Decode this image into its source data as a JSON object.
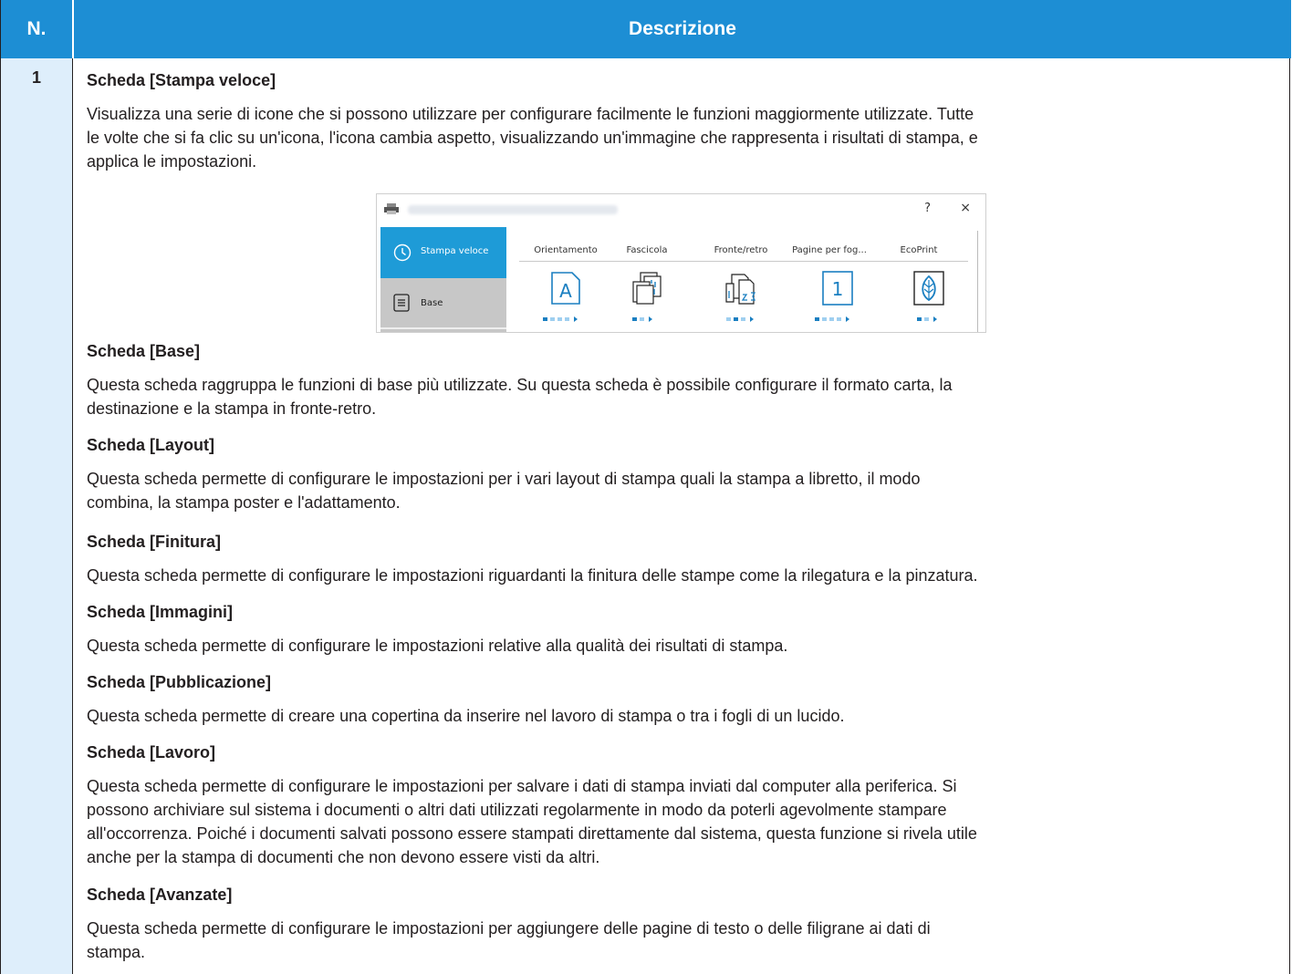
{
  "header": {
    "col_number": "N.",
    "col_description": "Descrizione"
  },
  "row": {
    "number": "1",
    "sections": [
      {
        "title": "Scheda [Stampa veloce]",
        "lines": [
          "Visualizza una serie di icone che si possono utilizzare per configurare facilmente le funzioni maggiormente utilizzate. Tutte",
          "le volte che si fa clic su un'icona, l'icona cambia aspetto, visualizzando un'immagine che rappresenta i risultati di stampa, e",
          "applica le impostazioni."
        ]
      },
      {
        "title": "Scheda [Base]",
        "lines": [
          "Questa scheda raggruppa le funzioni di base più utilizzate. Su questa scheda è possibile configurare il formato carta, la",
          "destinazione e la stampa in fronte-retro."
        ]
      },
      {
        "title": "Scheda [Layout]",
        "lines": [
          "Questa scheda permette di configurare le impostazioni per i vari layout di stampa quali la stampa a libretto, il modo",
          "combina, la stampa poster e l'adattamento."
        ]
      },
      {
        "title": "Scheda [Finitura]",
        "lines": [
          "Questa scheda permette di configurare le impostazioni riguardanti la finitura delle stampe come la rilegatura e la pinzatura."
        ]
      },
      {
        "title": "Scheda [Immagini]",
        "lines": [
          "Questa scheda permette di configurare le impostazioni relative alla qualità dei risultati di stampa."
        ]
      },
      {
        "title": "Scheda [Pubblicazione]",
        "lines": [
          "Questa scheda permette di creare una copertina da inserire nel lavoro di stampa o tra i fogli di un lucido."
        ]
      },
      {
        "title": "Scheda [Lavoro]",
        "lines": [
          "Questa scheda permette di configurare le impostazioni per salvare i dati di stampa inviati dal computer alla periferica. Si",
          "possono archiviare sul sistema i documenti o altri dati utilizzati regolarmente in modo da poterli agevolmente stampare",
          "all'occorrenza. Poiché i documenti salvati possono essere stampati direttamente dal sistema, questa funzione si rivela utile",
          "anche per la stampa di documenti che non devono essere visti da altri."
        ]
      },
      {
        "title": "Scheda [Avanzate]",
        "lines": [
          "Questa scheda permette di configurare le impostazioni per aggiungere delle pagine di testo o delle filigrane ai dati di",
          "stampa."
        ]
      }
    ]
  },
  "dialog": {
    "help_glyph": "?",
    "close_glyph": "×",
    "nav": [
      {
        "label": "Stampa veloce",
        "icon": "clock-icon"
      },
      {
        "label": "Base",
        "icon": "document-icon"
      }
    ],
    "quick_print": [
      {
        "label": "Orientamento",
        "icon_text": "A"
      },
      {
        "label": "Fascicola",
        "icon_text": ""
      },
      {
        "label": "Fronte/retro",
        "icon_text": ""
      },
      {
        "label": "Pagine per fog...",
        "icon_text": "1"
      },
      {
        "label": "EcoPrint",
        "icon_text": ""
      }
    ],
    "colors": {
      "accent": "#1e9bd7",
      "inactive_nav": "#c7c7c7",
      "icon_blue": "#1a7fc1"
    }
  }
}
